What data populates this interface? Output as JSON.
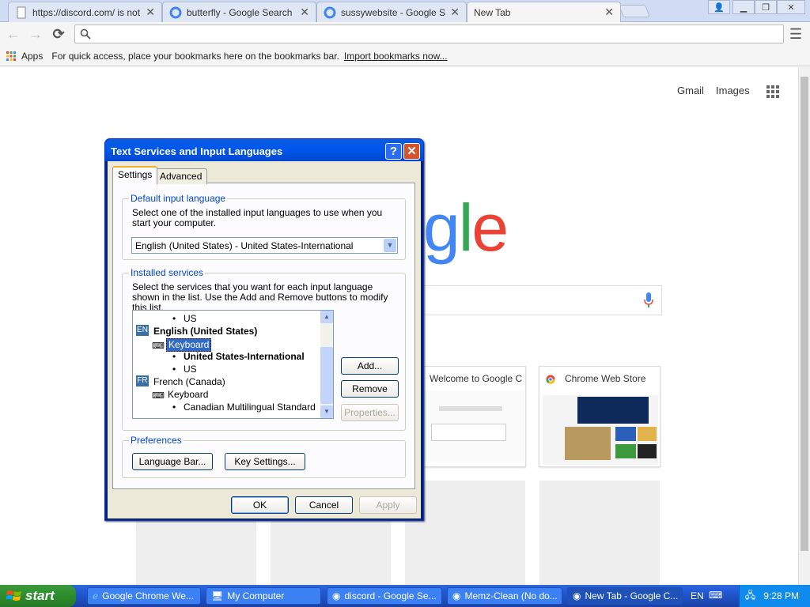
{
  "browser": {
    "tabs": [
      {
        "title": "https://discord.com/ is not a"
      },
      {
        "title": "butterfly - Google Search"
      },
      {
        "title": "sussywebsite - Google Search"
      },
      {
        "title": "New Tab"
      }
    ],
    "bookmarks_bar": {
      "apps_label": "Apps",
      "hint": "For quick access, place your bookmarks here on the bookmarks bar.",
      "import_link": "Import bookmarks now..."
    }
  },
  "newtab": {
    "gmail": "Gmail",
    "images": "Images",
    "logo_partial": "gle",
    "tiles": [
      {
        "title": "Welcome to Google C"
      },
      {
        "title": "Chrome Web Store"
      }
    ]
  },
  "dialog": {
    "title": "Text Services and Input Languages",
    "tabs": [
      "Settings",
      "Advanced"
    ],
    "default_group": {
      "label": "Default input language",
      "desc": "Select one of the installed input languages to use when you start your computer.",
      "selected": "English (United States) - United States-International"
    },
    "services_group": {
      "label": "Installed services",
      "desc": "Select the services that you want for each input language shown in the list. Use the Add and Remove buttons to modify this list.",
      "tree": {
        "us_top": "US",
        "en_code": "EN",
        "en_name": "English (United States)",
        "keyboard1": "Keyboard",
        "en_layout": "United States-International",
        "us": "US",
        "fr_code": "FR",
        "fr_name": "French (Canada)",
        "keyboard2": "Keyboard",
        "fr_layout": "Canadian Multilingual Standard"
      },
      "add": "Add...",
      "remove": "Remove",
      "properties": "Properties..."
    },
    "prefs_group": {
      "label": "Preferences",
      "language_bar": "Language Bar...",
      "key_settings": "Key Settings..."
    },
    "ok": "OK",
    "cancel": "Cancel",
    "apply": "Apply"
  },
  "taskbar": {
    "start": "start",
    "items": [
      "Google Chrome We...",
      "My Computer",
      "discord - Google Se...",
      "Memz-Clean (No do...",
      "New Tab - Google C..."
    ],
    "lang": "EN",
    "time": "9:28 PM"
  }
}
